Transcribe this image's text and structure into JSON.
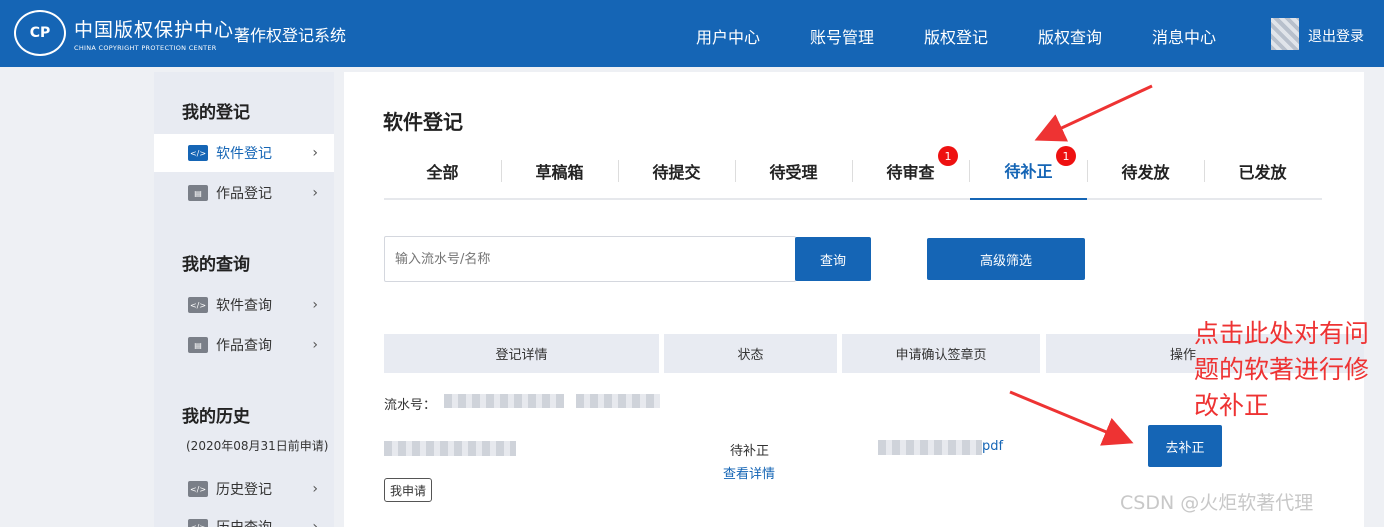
{
  "header": {
    "logo_cn": "中国版权保护中心",
    "logo_en": "CHINA COPYRIGHT PROTECTION CENTER",
    "system_title": "著作权登记系统",
    "nav": [
      "用户中心",
      "账号管理",
      "版权登记",
      "版权查询",
      "消息中心"
    ],
    "logout": "退出登录"
  },
  "sidebar": {
    "groups": [
      {
        "title": "我的登记",
        "items": [
          {
            "label": "软件登记",
            "icon": "software-icon",
            "active": true
          },
          {
            "label": "作品登记",
            "icon": "work-icon",
            "active": false
          }
        ]
      },
      {
        "title": "我的查询",
        "items": [
          {
            "label": "软件查询",
            "icon": "software-icon"
          },
          {
            "label": "作品查询",
            "icon": "work-icon"
          }
        ]
      },
      {
        "title": "我的历史",
        "note": "(2020年08月31日前申请)",
        "items": [
          {
            "label": "历史登记",
            "icon": "history-icon"
          },
          {
            "label": "历史查询",
            "icon": "history-icon"
          }
        ]
      }
    ]
  },
  "main": {
    "title": "软件登记",
    "tabs": [
      {
        "label": "全部"
      },
      {
        "label": "草稿箱"
      },
      {
        "label": "待提交"
      },
      {
        "label": "待受理"
      },
      {
        "label": "待审查",
        "badge": "1"
      },
      {
        "label": "待补正",
        "badge": "1",
        "active": true
      },
      {
        "label": "待发放"
      },
      {
        "label": "已发放"
      }
    ],
    "search_placeholder": "输入流水号/名称",
    "search_button": "查询",
    "advanced_button": "高级筛选",
    "table_headers": [
      "登记详情",
      "状态",
      "申请确认签章页",
      "操作"
    ],
    "row": {
      "serial_label": "流水号：",
      "status": "待补正",
      "detail_link": "查看详情",
      "file_suffix": "pdf",
      "tag": "我申请",
      "action": "去补正"
    }
  },
  "annotation": "点击此处对有问题的软著进行修改补正",
  "watermark": "CSDN @火炬软著代理",
  "colors": {
    "brand": "#1565b5",
    "badge": "#e11111",
    "annotation": "#e33333"
  }
}
